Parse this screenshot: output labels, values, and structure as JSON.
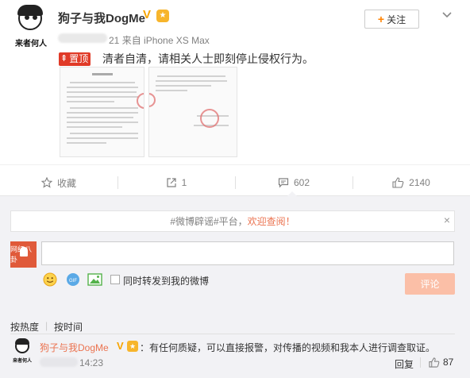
{
  "post": {
    "author_name": "狗子与我DogMe",
    "author_avatar_caption": "来者何人",
    "verified_mark": "V",
    "follow_label": "关注",
    "follow_icon": "+",
    "meta_time": "21",
    "meta_source": "来自 iPhone XS Max",
    "pinned_tag": "置顶",
    "text": "清者自清，请相关人士即刻停止侵权行为。"
  },
  "actions": {
    "favorite_label": "收藏",
    "repost_count": "1",
    "comment_count": "602",
    "like_count": "2140"
  },
  "notice": {
    "before": "#微博辟谣#平台，",
    "highlight": "欢迎查阅！",
    "close": "×"
  },
  "composer": {
    "my_avatar_caption": "网红八卦",
    "gif_label": "GIF",
    "repost_checkbox_label": "同时转发到我的微博",
    "submit_label": "评论"
  },
  "sort": {
    "hot_label": "按热度",
    "separator": "|",
    "time_label": "按时间"
  },
  "comments": [
    {
      "user": "狗子与我DogMe",
      "avatar_caption": "来者何人",
      "text": "：有任何质疑，可以直接报警，对传播的视频和我本人进行调查取证。",
      "time": "14:23",
      "reply_label": "回复",
      "likes": "87"
    }
  ],
  "colors": {
    "accent_orange": "#ff8200",
    "pinned_red": "#e03a27",
    "link_orange": "#eb7350",
    "verified_gold": "#f7a400",
    "submit_disabled": "#fbbfa7",
    "panel_bg": "#f2f2f5"
  },
  "icons": [
    "star-icon",
    "repost-icon",
    "comment-icon",
    "like-icon",
    "chevron-down-icon",
    "emoji-icon",
    "gif-icon",
    "picture-icon",
    "close-icon"
  ]
}
